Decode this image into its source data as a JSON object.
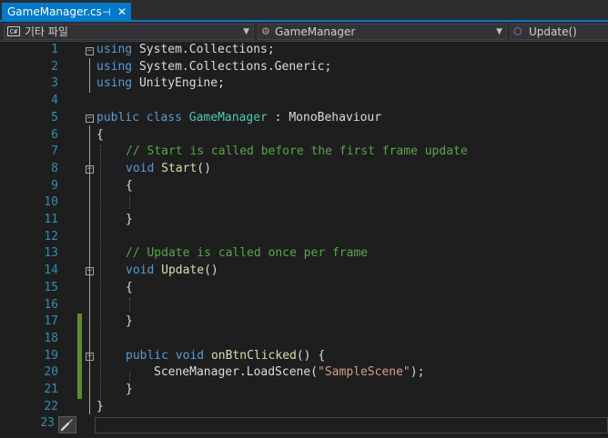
{
  "tab": {
    "filename": "GameManager.cs",
    "pin_glyph": "⊣",
    "close_glyph": "✕"
  },
  "navbar": {
    "project": "기타 파일",
    "project_icon": "C#",
    "class": "GameManager",
    "member": "Update()"
  },
  "editor": {
    "line_numbers": [
      "1",
      "2",
      "3",
      "4",
      "5",
      "6",
      "7",
      "8",
      "9",
      "10",
      "11",
      "12",
      "13",
      "14",
      "15",
      "16",
      "17",
      "18",
      "19",
      "20",
      "21",
      "22",
      "23"
    ]
  },
  "colors": {
    "accent": "#007acc",
    "background": "#1e1e1e",
    "keyword": "#569cd6",
    "type": "#4ec9b0",
    "comment": "#57a64a",
    "string": "#d69d85",
    "line_number": "#2b91af",
    "changed": "#5e8c31"
  },
  "code": {
    "l1": [
      "using",
      " System.Collections;"
    ],
    "l2": [
      "using",
      " System.Collections.Generic;"
    ],
    "l3": [
      "using",
      " UnityEngine;"
    ],
    "l5": [
      "public",
      " ",
      "class",
      " ",
      "GameManager",
      " : MonoBehaviour"
    ],
    "l6": "{",
    "l7": "// Start is called before the first frame update",
    "l8": [
      "void",
      " ",
      "Start",
      "()"
    ],
    "l9": "{",
    "l11": "}",
    "l13": "// Update is called once per frame",
    "l14": [
      "void",
      " ",
      "Update",
      "()"
    ],
    "l15": "{",
    "l17": "}",
    "l19": [
      "public",
      " ",
      "void",
      " ",
      "onBtnClicked",
      "() {"
    ],
    "l20": [
      "SceneManager.LoadScene(",
      "\"SampleScene\"",
      ");"
    ],
    "l21": "}",
    "l22": "}"
  }
}
